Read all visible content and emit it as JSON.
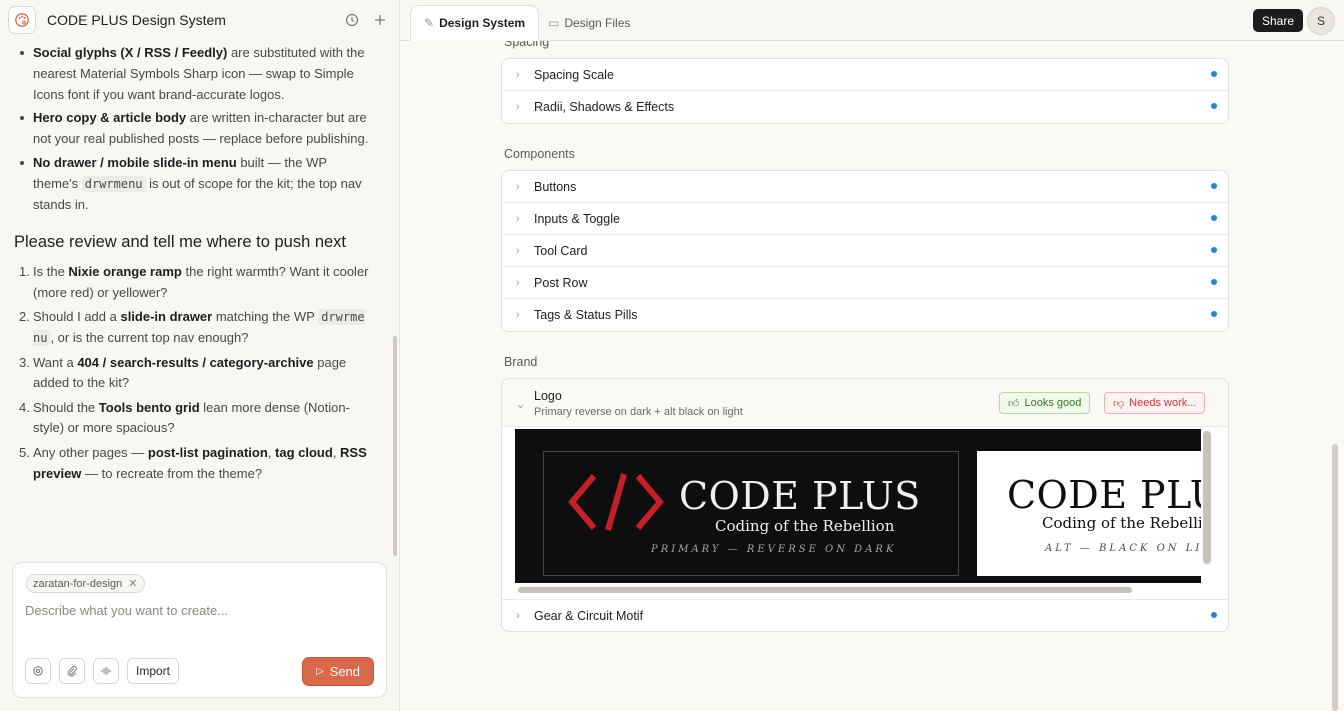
{
  "header": {
    "title": "CODE PLUS Design System"
  },
  "chat": {
    "bullets": [
      {
        "bold": "Social glyphs (X / RSS / Feedly)",
        "text": " are substituted with the nearest Material Symbols Sharp icon — swap to Simple Icons font if you want brand-accurate logos."
      },
      {
        "bold": "Hero copy & article body",
        "text": " are written in-character but are not your real published posts — replace before publishing."
      },
      {
        "bold": "No drawer / mobile slide-in menu",
        "text": " built — the WP theme's ",
        "code": "drwrmenu",
        "text2": " is out of scope for the kit; the top nav stands in."
      }
    ],
    "review_heading": "Please review and tell me where to push next",
    "questions": [
      {
        "num": "1.",
        "pre": "Is the ",
        "b1": "Nixie orange ramp",
        "post": " the right warmth? Want it cooler (more red) or yellower?"
      },
      {
        "num": "2.",
        "pre": "Should I add a ",
        "b1": "slide-in drawer",
        "mid": " matching the WP ",
        "code": "drwrmenu",
        "post": ", or is the current top nav enough?"
      },
      {
        "num": "3.",
        "pre": "Want a ",
        "b1": "404 / search-results / category-archive",
        "post": " page added to the kit?"
      },
      {
        "num": "4.",
        "pre": "Should the ",
        "b1": "Tools bento grid",
        "post": " lean more dense (Notion-style) or more spacious?"
      },
      {
        "num": "5.",
        "pre": "Any other pages — ",
        "b1": "post-list pagination",
        "mid1": ", ",
        "b2": "tag cloud",
        "mid2": ", ",
        "b3": "RSS preview",
        "post": " — to recreate from the theme?"
      }
    ]
  },
  "composer": {
    "chip": "zaratan-for-design",
    "placeholder": "Describe what you want to create...",
    "import_label": "Import",
    "send_label": "Send"
  },
  "tabs": [
    {
      "label": "Design System",
      "active": true
    },
    {
      "label": "Design Files",
      "active": false
    }
  ],
  "topbar": {
    "share_label": "Share",
    "avatar_initial": "S"
  },
  "sections": {
    "spacing": {
      "label": "Spacing",
      "items": [
        "Spacing Scale",
        "Radii, Shadows & Effects"
      ]
    },
    "components": {
      "label": "Components",
      "items": [
        "Buttons",
        "Inputs & Toggle",
        "Tool Card",
        "Post Row",
        "Tags & Status Pills"
      ]
    },
    "brand": {
      "label": "Brand",
      "logo": {
        "title": "Logo",
        "subtitle": "Primary reverse on dark + alt black on light",
        "good_label": "Looks good",
        "needs_label": "Needs work..."
      },
      "items": [
        "Gear & Circuit Motif"
      ]
    }
  },
  "logo_preview": {
    "primary": {
      "wordmark": "CODE PLUS",
      "tagline": "Coding of the Rebellion",
      "caption": "PRIMARY — REVERSE ON DARK"
    },
    "alt": {
      "wordmark": "CODE PLUS",
      "tagline": "Coding of the Rebellion",
      "caption": "ALT — BLACK ON LIGHT"
    }
  },
  "colors": {
    "accent": "#d9694a",
    "dot": "#2f7fd6",
    "brand_red": "#c4202a",
    "dark_bg": "#0e0e0e"
  }
}
